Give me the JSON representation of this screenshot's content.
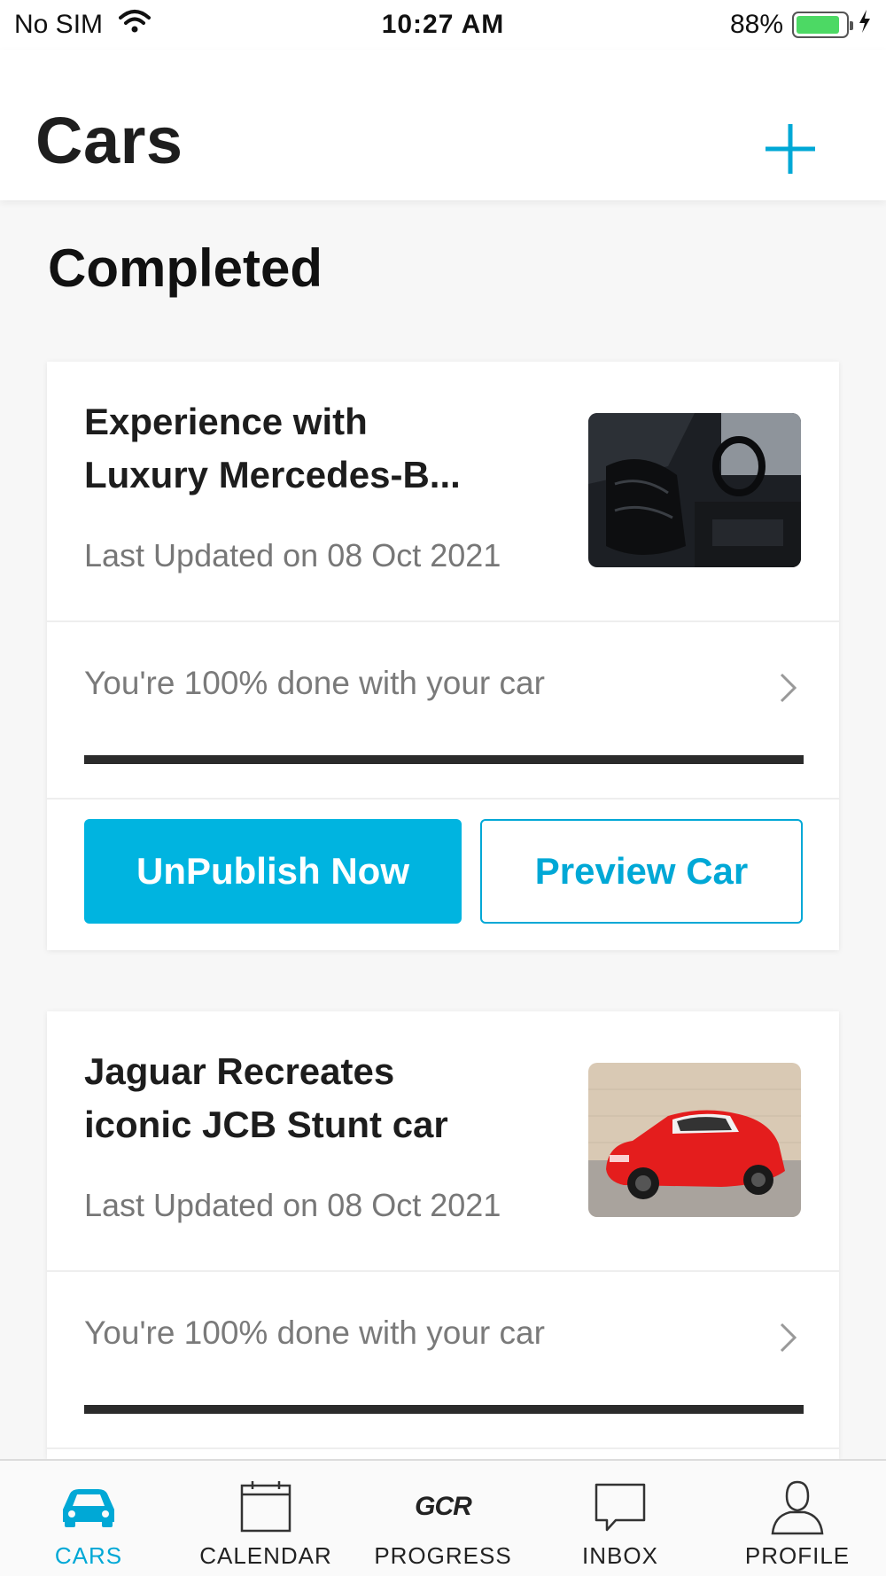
{
  "status_bar": {
    "carrier": "No SIM",
    "time": "10:27 AM",
    "battery_text": "88%",
    "battery_level": 0.88,
    "wifi_icon": "wifi-icon",
    "charging_icon": "bolt-icon"
  },
  "header": {
    "title": "Cars",
    "add_icon": "plus-icon"
  },
  "section": {
    "title": "Completed"
  },
  "cards": [
    {
      "title": "Experience with\nLuxury Mercedes-B...",
      "updated": "Last Updated on 08 Oct 2021",
      "image": "car-interior-photo",
      "progress_text": "You're 100% done with your car",
      "progress": 1.0,
      "primary_button": "UnPublish Now",
      "secondary_button": "Preview Car"
    },
    {
      "title": "Jaguar Recreates\niconic JCB Stunt car",
      "updated": "Last Updated on 08 Oct 2021",
      "image": "red-sports-car-photo",
      "progress_text": "You're 100% done with your car",
      "progress": 1.0
    }
  ],
  "tabs": [
    {
      "label": "CARS",
      "icon": "car-icon",
      "active": true
    },
    {
      "label": "CALENDAR",
      "icon": "calendar-icon",
      "active": false
    },
    {
      "label": "PROGRESS",
      "icon": "gcr-logo",
      "logo_text": "GCR",
      "active": false
    },
    {
      "label": "INBOX",
      "icon": "chat-bubble-icon",
      "active": false
    },
    {
      "label": "PROFILE",
      "icon": "person-icon",
      "active": false
    }
  ],
  "colors": {
    "accent": "#00b4e0",
    "progress_fill": "#2b2b2b",
    "battery": "#4cd964"
  }
}
